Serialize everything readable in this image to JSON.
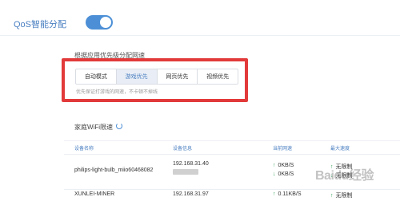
{
  "qos": {
    "label": "QoS智能分配",
    "enabled": true
  },
  "priority": {
    "title": "根据应用优先级分配网速",
    "modes": [
      {
        "label": "自动模式",
        "active": false
      },
      {
        "label": "游戏优先",
        "active": true
      },
      {
        "label": "网页优先",
        "active": false
      },
      {
        "label": "视频优先",
        "active": false
      }
    ],
    "note": "优先保证打游戏的网速，不卡顿不掉线"
  },
  "wifi": {
    "title": "家庭WiFi限速",
    "headers": {
      "name": "设备名称",
      "info": "设备信息",
      "speed": "当前网速",
      "max": "最大速度"
    },
    "rows": [
      {
        "name": "philips-light-bulb_miio60468082",
        "ip": "192.168.31.40",
        "up": "0KB/S",
        "down": "0KB/S",
        "max_up": "无限制",
        "max_down": "无限制"
      },
      {
        "name": "XUNLEI-MINER",
        "ip": "192.168.31.97",
        "up": "0.11KB/S",
        "max_up": "无限制"
      }
    ]
  },
  "colors": {
    "accent": "#4c8fd6",
    "highlight_box": "#e23a3a",
    "arrow": "#33a35a"
  },
  "watermark": "Baidu经验"
}
